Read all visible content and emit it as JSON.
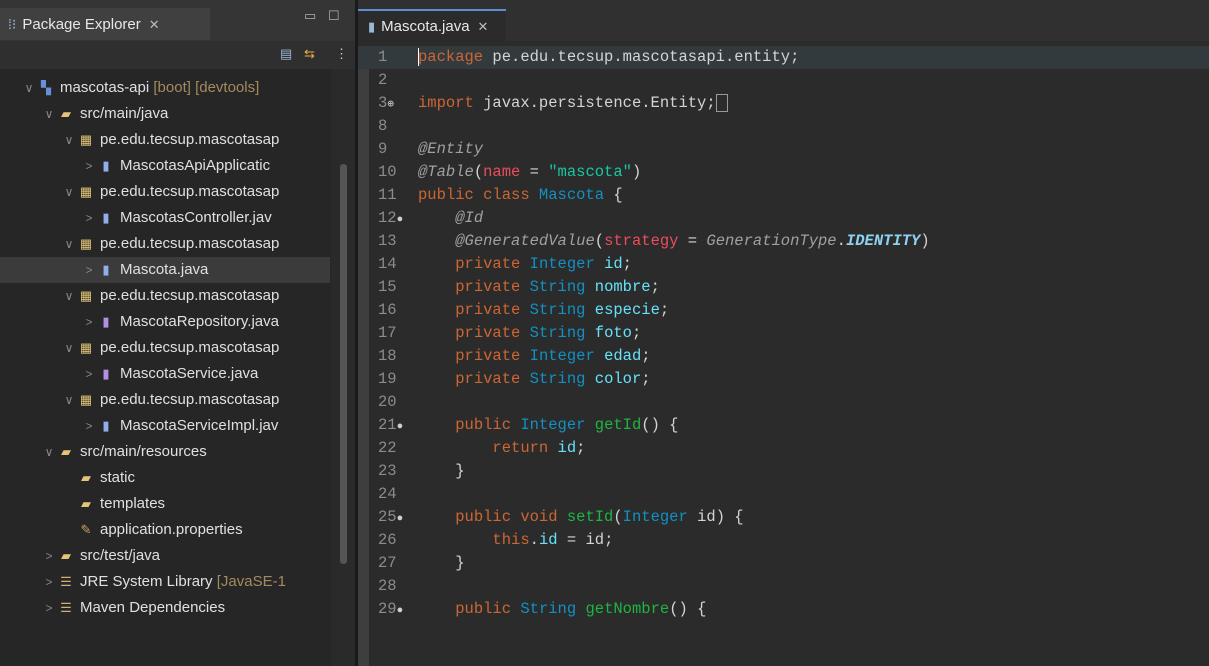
{
  "explorer": {
    "title": "Package Explorer",
    "tree": [
      {
        "label": "mascotas-api",
        "decoration": " [boot] [devtools]",
        "icon": "project-icon",
        "level": 0,
        "chevron": "∨",
        "selected": false
      },
      {
        "label": "src/main/java",
        "decoration": "",
        "icon": "source-folder-icon",
        "level": 1,
        "chevron": "∨",
        "selected": false
      },
      {
        "label": "pe.edu.tecsup.mascotasap",
        "decoration": "",
        "icon": "package-icon",
        "level": 2,
        "chevron": "∨",
        "selected": false
      },
      {
        "label": "MascotasApiApplicatic",
        "decoration": "",
        "icon": "java-file-icon",
        "level": 3,
        "chevron": ">",
        "selected": false
      },
      {
        "label": "pe.edu.tecsup.mascotasap",
        "decoration": "",
        "icon": "package-icon",
        "level": 2,
        "chevron": "∨",
        "selected": false
      },
      {
        "label": "MascotasController.jav",
        "decoration": "",
        "icon": "java-file-icon",
        "level": 3,
        "chevron": ">",
        "selected": false
      },
      {
        "label": "pe.edu.tecsup.mascotasap",
        "decoration": "",
        "icon": "package-icon",
        "level": 2,
        "chevron": "∨",
        "selected": false
      },
      {
        "label": "Mascota.java",
        "decoration": "",
        "icon": "java-file-icon",
        "level": 3,
        "chevron": ">",
        "selected": true
      },
      {
        "label": "pe.edu.tecsup.mascotasap",
        "decoration": "",
        "icon": "package-icon",
        "level": 2,
        "chevron": "∨",
        "selected": false
      },
      {
        "label": "MascotaRepository.java",
        "decoration": "",
        "icon": "interface-file-icon",
        "level": 3,
        "chevron": ">",
        "selected": false
      },
      {
        "label": "pe.edu.tecsup.mascotasap",
        "decoration": "",
        "icon": "package-icon",
        "level": 2,
        "chevron": "∨",
        "selected": false
      },
      {
        "label": "MascotaService.java",
        "decoration": "",
        "icon": "interface-file-icon",
        "level": 3,
        "chevron": ">",
        "selected": false
      },
      {
        "label": "pe.edu.tecsup.mascotasap",
        "decoration": "",
        "icon": "package-icon",
        "level": 2,
        "chevron": "∨",
        "selected": false
      },
      {
        "label": "MascotaServiceImpl.jav",
        "decoration": "",
        "icon": "java-file-icon",
        "level": 3,
        "chevron": ">",
        "selected": false
      },
      {
        "label": "src/main/resources",
        "decoration": "",
        "icon": "resource-folder-icon",
        "level": 1,
        "chevron": "∨",
        "selected": false
      },
      {
        "label": "static",
        "decoration": "",
        "icon": "folder-icon",
        "level": 2,
        "chevron": "",
        "selected": false
      },
      {
        "label": "templates",
        "decoration": "",
        "icon": "folder-icon",
        "level": 2,
        "chevron": "",
        "selected": false
      },
      {
        "label": "application.properties",
        "decoration": "",
        "icon": "properties-file-icon",
        "level": 2,
        "chevron": "",
        "selected": false
      },
      {
        "label": "src/test/java",
        "decoration": "",
        "icon": "source-folder-icon",
        "level": 1,
        "chevron": ">",
        "selected": false
      },
      {
        "label": "JRE System Library",
        "decoration": " [JavaSE-1",
        "icon": "library-icon",
        "level": 1,
        "chevron": ">",
        "selected": false
      },
      {
        "label": "Maven Dependencies",
        "decoration": "",
        "icon": "library-icon",
        "level": 1,
        "chevron": ">",
        "selected": false
      }
    ]
  },
  "editor": {
    "tab_label": "Mascota.java",
    "lines": [
      {
        "n": "1",
        "fold": "",
        "tokens": [
          [
            "kw",
            "package"
          ],
          [
            "plain",
            " pe.edu.tecsup.mascotasapi.entity;"
          ]
        ]
      },
      {
        "n": "2",
        "fold": "",
        "tokens": []
      },
      {
        "n": "3",
        "fold": "⊕",
        "tokens": [
          [
            "kw",
            "import"
          ],
          [
            "plain",
            " javax.persistence.Entity;"
          ]
        ]
      },
      {
        "n": "8",
        "fold": "",
        "tokens": []
      },
      {
        "n": "9",
        "fold": "",
        "tokens": [
          [
            "ann",
            "@Entity"
          ]
        ]
      },
      {
        "n": "10",
        "fold": "",
        "tokens": [
          [
            "ann",
            "@Table"
          ],
          [
            "plain",
            "("
          ],
          [
            "attr",
            "name"
          ],
          [
            "plain",
            " = "
          ],
          [
            "str",
            "\"mascota\""
          ],
          [
            "plain",
            ")"
          ]
        ]
      },
      {
        "n": "11",
        "fold": "",
        "tokens": [
          [
            "mod",
            "public class "
          ],
          [
            "typ",
            "Mascota"
          ],
          [
            "plain",
            " {"
          ]
        ]
      },
      {
        "n": "12",
        "fold": "●",
        "tokens": [
          [
            "plain",
            "    "
          ],
          [
            "ann",
            "@Id"
          ]
        ]
      },
      {
        "n": "13",
        "fold": "",
        "tokens": [
          [
            "plain",
            "    "
          ],
          [
            "ann",
            "@GeneratedValue"
          ],
          [
            "plain",
            "("
          ],
          [
            "attr",
            "strategy"
          ],
          [
            "plain",
            " = "
          ],
          [
            "itype",
            "GenerationType"
          ],
          [
            "plain",
            "."
          ],
          [
            "enumc",
            "IDENTITY"
          ],
          [
            "plain",
            ")"
          ]
        ]
      },
      {
        "n": "14",
        "fold": "",
        "tokens": [
          [
            "plain",
            "    "
          ],
          [
            "mod",
            "private "
          ],
          [
            "typ",
            "Integer "
          ],
          [
            "fld",
            "id"
          ],
          [
            "plain",
            ";"
          ]
        ]
      },
      {
        "n": "15",
        "fold": "",
        "tokens": [
          [
            "plain",
            "    "
          ],
          [
            "mod",
            "private "
          ],
          [
            "typ",
            "String "
          ],
          [
            "fld",
            "nombre"
          ],
          [
            "plain",
            ";"
          ]
        ]
      },
      {
        "n": "16",
        "fold": "",
        "tokens": [
          [
            "plain",
            "    "
          ],
          [
            "mod",
            "private "
          ],
          [
            "typ",
            "String "
          ],
          [
            "fld",
            "especie"
          ],
          [
            "plain",
            ";"
          ]
        ]
      },
      {
        "n": "17",
        "fold": "",
        "tokens": [
          [
            "plain",
            "    "
          ],
          [
            "mod",
            "private "
          ],
          [
            "typ",
            "String "
          ],
          [
            "fld",
            "foto"
          ],
          [
            "plain",
            ";"
          ]
        ]
      },
      {
        "n": "18",
        "fold": "",
        "tokens": [
          [
            "plain",
            "    "
          ],
          [
            "mod",
            "private "
          ],
          [
            "typ",
            "Integer "
          ],
          [
            "fld",
            "edad"
          ],
          [
            "plain",
            ";"
          ]
        ]
      },
      {
        "n": "19",
        "fold": "",
        "tokens": [
          [
            "plain",
            "    "
          ],
          [
            "mod",
            "private "
          ],
          [
            "typ",
            "String "
          ],
          [
            "fld",
            "color"
          ],
          [
            "plain",
            ";"
          ]
        ]
      },
      {
        "n": "20",
        "fold": "",
        "tokens": []
      },
      {
        "n": "21",
        "fold": "●",
        "tokens": [
          [
            "plain",
            "    "
          ],
          [
            "mod",
            "public "
          ],
          [
            "typ",
            "Integer "
          ],
          [
            "mth",
            "getId"
          ],
          [
            "plain",
            "() {"
          ]
        ]
      },
      {
        "n": "22",
        "fold": "",
        "tokens": [
          [
            "plain",
            "        "
          ],
          [
            "kw",
            "return "
          ],
          [
            "fld",
            "id"
          ],
          [
            "plain",
            ";"
          ]
        ]
      },
      {
        "n": "23",
        "fold": "",
        "tokens": [
          [
            "plain",
            "    }"
          ]
        ]
      },
      {
        "n": "24",
        "fold": "",
        "tokens": []
      },
      {
        "n": "25",
        "fold": "●",
        "tokens": [
          [
            "plain",
            "    "
          ],
          [
            "mod",
            "public void "
          ],
          [
            "mth",
            "setId"
          ],
          [
            "plain",
            "("
          ],
          [
            "typ",
            "Integer "
          ],
          [
            "plain",
            "id) {"
          ]
        ]
      },
      {
        "n": "26",
        "fold": "",
        "tokens": [
          [
            "plain",
            "        "
          ],
          [
            "kw",
            "this"
          ],
          [
            "plain",
            "."
          ],
          [
            "fld",
            "id"
          ],
          [
            "plain",
            " = id;"
          ]
        ]
      },
      {
        "n": "27",
        "fold": "",
        "tokens": [
          [
            "plain",
            "    }"
          ]
        ]
      },
      {
        "n": "28",
        "fold": "",
        "tokens": []
      },
      {
        "n": "29",
        "fold": "●",
        "tokens": [
          [
            "plain",
            "    "
          ],
          [
            "mod",
            "public "
          ],
          [
            "typ",
            "String "
          ],
          [
            "mth",
            "getNombre"
          ],
          [
            "plain",
            "() {"
          ]
        ]
      }
    ]
  }
}
